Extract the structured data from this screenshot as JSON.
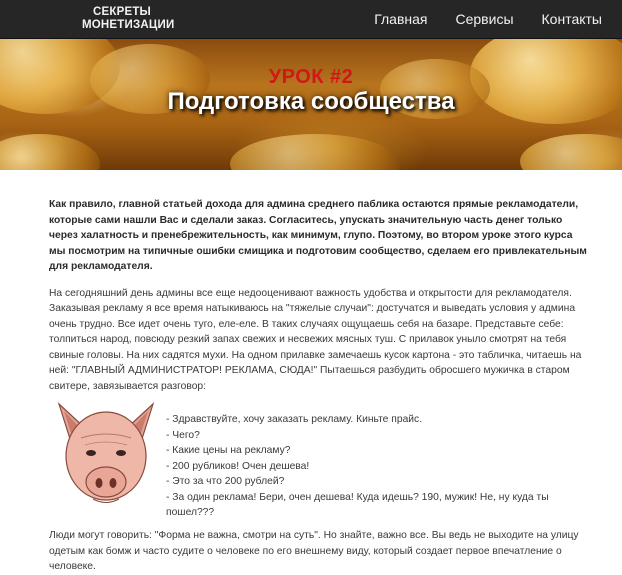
{
  "header": {
    "logo_line1": "СЕКРЕТЫ",
    "logo_line2": "МОНЕТИЗАЦИИ",
    "nav": [
      {
        "label": "Главная"
      },
      {
        "label": "Сервисы"
      },
      {
        "label": "Контакты"
      }
    ]
  },
  "hero": {
    "lesson": "УРОК #2",
    "title": "Подготовка сообщества"
  },
  "article": {
    "lead": "Как правило, главной статьей дохода для админа среднего паблика остаются прямые рекламодатели, которые сами нашли Вас и сделали заказ. Согласитесь, упускать значительную часть денег только через халатность и пренебрежительность, как минимум, глупо. Поэтому, во втором уроке этого курса мы посмотрим на типичные ошибки смищика и подготовим сообщество, сделаем его привлекательным для рекламодателя.",
    "paragraph1": "На сегодняшний день админы все еще недооценивают важность удобства и открытости для рекламодателя. Заказывая рекламу я все время натыкиваюсь на \"тяжелые случаи\": достучатся и выведать условия у админа очень трудно. Все идет очень туго, еле-еле. В таких случаях ощущаешь себя на базаре. Представьте себе: толпиться народ, повсюду резкий запах свежих и несвежих мясных туш. С прилавок уныло смотрят на тебя свиные головы. На них садятся мухи. На одном прилавке замечаешь кусок картона - это табличка, читаешь на ней: \"ГЛАВНЫЙ АДМИНИСТРАТОР! РЕКЛАМА, СЮДА!\" Пытаешься разбудить обросшего мужичка в старом свитере, завязывается разговор:",
    "dialog": [
      "- Здравствуйте, хочу заказать рекламу. Киньте прайс.",
      "- Чего?",
      "- Какие цены на рекламу?",
      "- 200 рубликов! Очен дешева!",
      "- Это за что 200 рублей?",
      "- За один реклама! Бери, очен дешева! Куда идешь? 190, мужик! Не, ну куда ты пошел???"
    ],
    "paragraph2": "Люди могут говорить: \"Форма не важна, смотри на суть\". Но знайте, важно все. Вы ведь не выходите на улицу одетым как бомж и часто судите о человеке по его внешнему виду, который создает первое впечатление о человеке."
  }
}
